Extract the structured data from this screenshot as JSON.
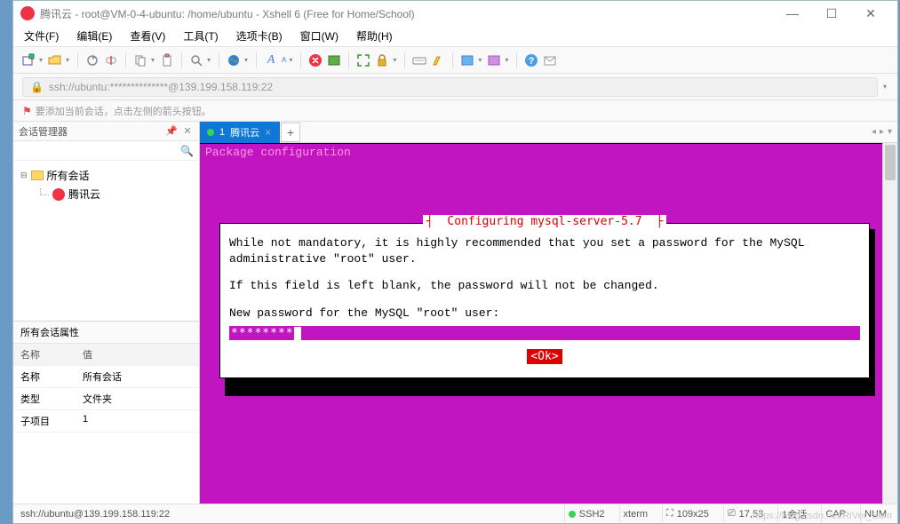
{
  "titlebar": {
    "text": "腾讯云 - root@VM-0-4-ubuntu: /home/ubuntu - Xshell 6 (Free for Home/School)"
  },
  "menubar": {
    "file": "文件(F)",
    "edit": "编辑(E)",
    "view": "查看(V)",
    "tools": "工具(T)",
    "tabs": "选项卡(B)",
    "window": "窗口(W)",
    "help": "帮助(H)"
  },
  "addressbar": {
    "url": "ssh://ubuntu:**************@139.199.158.119:22"
  },
  "hint": "要添加当前会话，点击左侧的箭头按钮。",
  "sidebar": {
    "title": "会话管理器",
    "root": "所有会话",
    "session": "腾讯云",
    "props_title": "所有会话属性",
    "cols": {
      "name": "名称",
      "value": "值"
    },
    "rows": {
      "name_label": "名称",
      "name_value": "所有会话",
      "type_label": "类型",
      "type_value": "文件夹",
      "child_label": "子项目",
      "child_value": "1"
    }
  },
  "tab": {
    "index": "1",
    "label": "腾讯云",
    "add": "+"
  },
  "terminal": {
    "header": "Package configuration",
    "dialog_title": "Configuring mysql-server-5.7",
    "line1": "While not mandatory, it is highly recommended that you set a password for the MySQL administrative \"root\" user.",
    "line2": "If this field is left blank, the password will not be changed.",
    "line3": "New password for the MySQL \"root\" user:",
    "password_mask": "********",
    "ok": "<Ok>"
  },
  "status": {
    "conn": "ssh://ubuntu@139.199.158.119:22",
    "proto": "SSH2",
    "term": "xterm",
    "size": "109x25",
    "cursor": "17,53",
    "session": "1会话",
    "cap": "CAP",
    "num": "NUM"
  },
  "watermark": "https://blog.csdn.net/RiVer_Sum"
}
